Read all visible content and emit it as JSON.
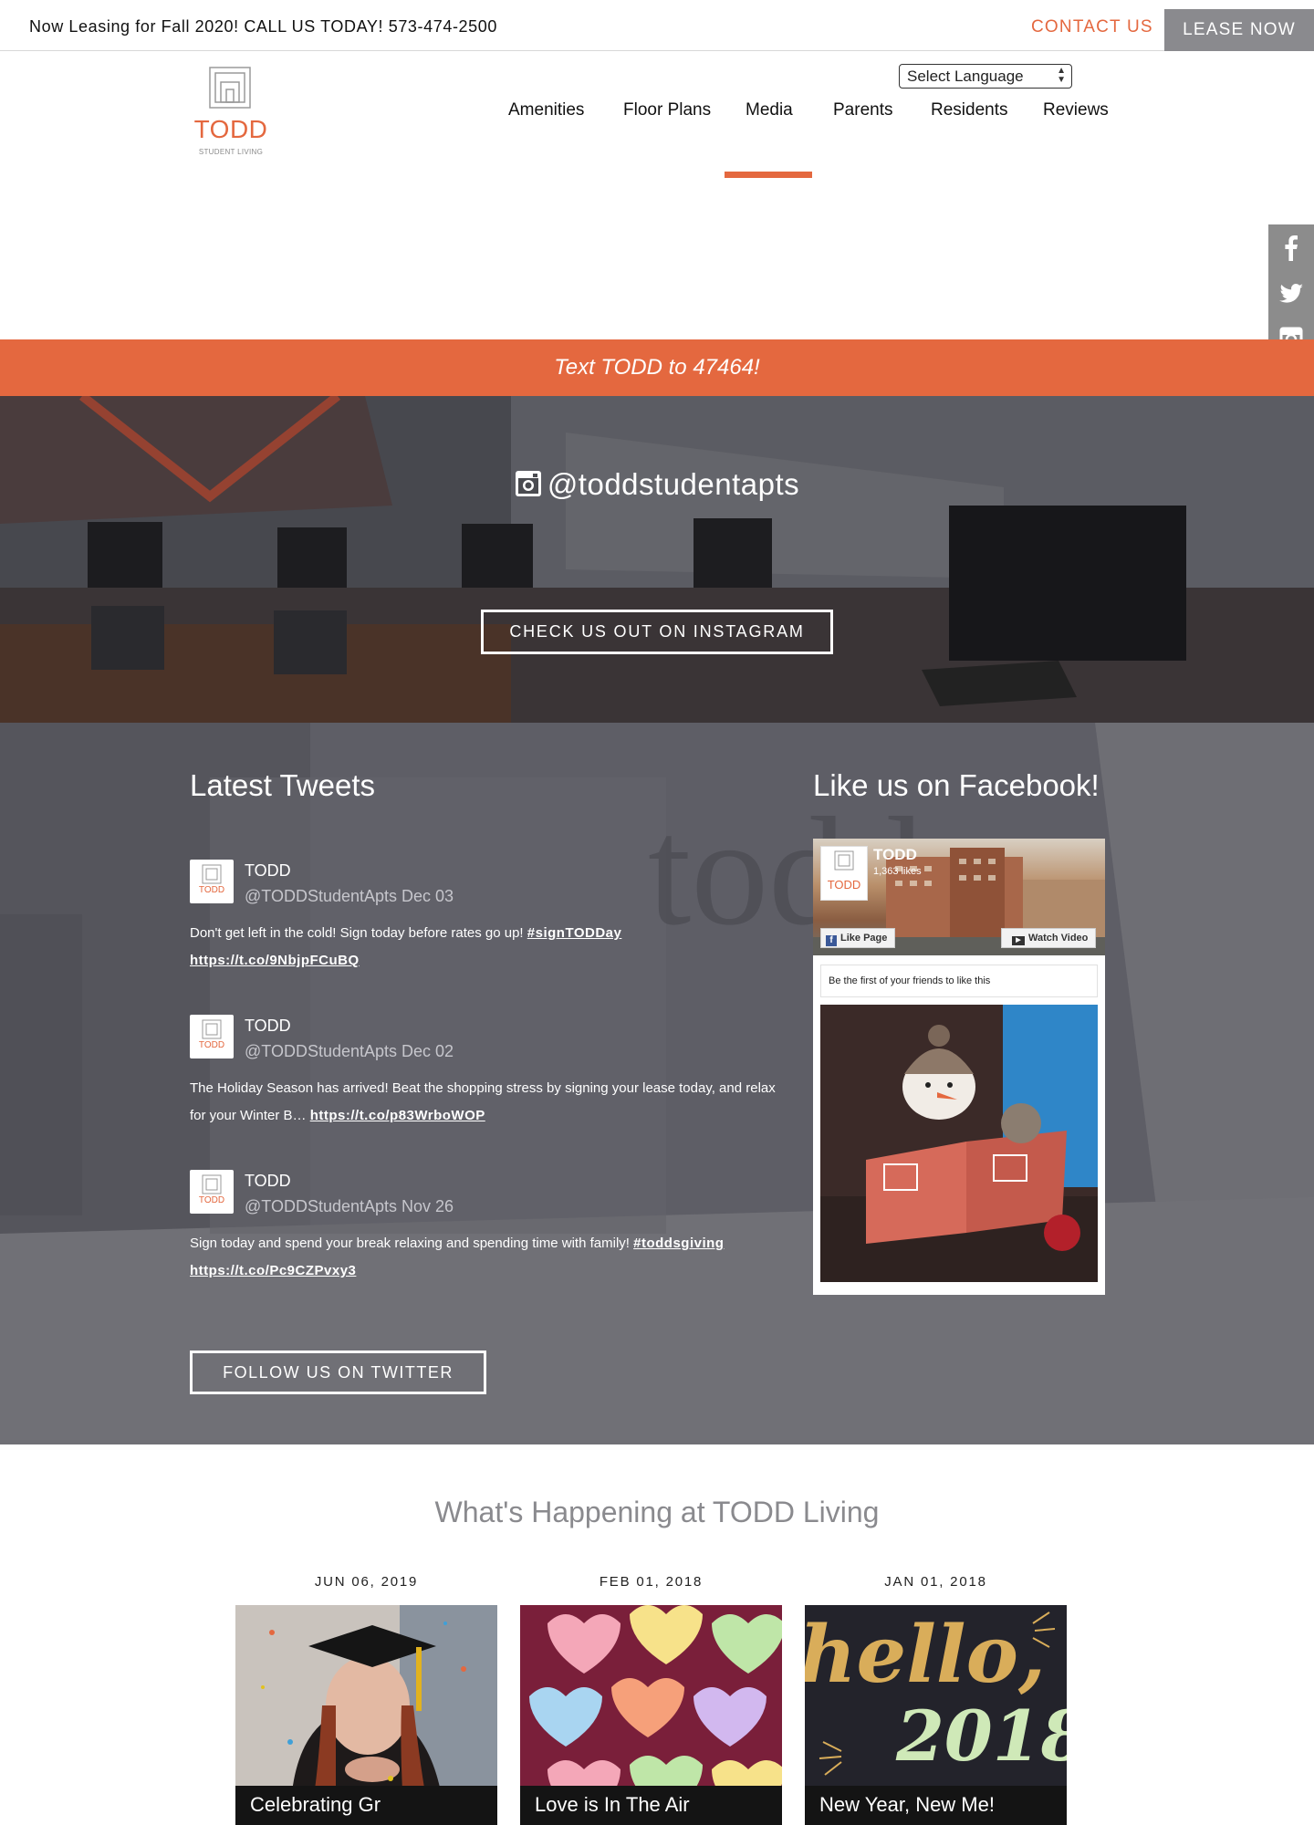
{
  "topbar": {
    "promo": "Now Leasing for Fall 2020! CALL US TODAY! 573-474-2500",
    "contact": "CONTACT US",
    "lease": "LEASE NOW"
  },
  "brand": {
    "name": "TODD",
    "tagline": "STUDENT LIVING"
  },
  "language": {
    "selected": "Select Language"
  },
  "nav": {
    "items": [
      "Amenities",
      "Floor Plans",
      "Media",
      "Parents",
      "Residents",
      "Reviews"
    ],
    "active": "Media"
  },
  "social": [
    "facebook-icon",
    "twitter-icon",
    "instagram-icon"
  ],
  "textbar": "Text TODD to 47464!",
  "instagram": {
    "handle": "@toddstudentapts",
    "button": "CHECK US OUT ON INSTAGRAM"
  },
  "tweets": {
    "title": "Latest Tweets",
    "items": [
      {
        "name": "TODD",
        "handle": "@TODDStudentApts",
        "date": "Dec 03",
        "text": "Don't get left in the cold! Sign today before rates go up! ",
        "tag": "#signTODDay",
        "link": "https://t.co/9NbjpFCuBQ"
      },
      {
        "name": "TODD",
        "handle": "@TODDStudentApts",
        "date": "Dec 02",
        "text": "The Holiday Season has arrived! Beat the shopping stress by signing your lease today, and relax for your Winter B… ",
        "tag": "",
        "link": "https://t.co/p83WrboWOP"
      },
      {
        "name": "TODD",
        "handle": "@TODDStudentApts",
        "date": "Nov 26",
        "text": "Sign today and spend your break relaxing and spending time with family! ",
        "tag": "#toddsgiving",
        "link": "https://t.co/Pc9CZPvxy3"
      }
    ],
    "follow": "FOLLOW US ON TWITTER"
  },
  "facebook": {
    "title": "Like us on Facebook!",
    "page_name": "TODD",
    "likes": "1,363 likes",
    "like_button": "Like Page",
    "watch_button": "Watch Video",
    "friends_text": "Be the first of your friends to like this"
  },
  "happening": {
    "title": "What's Happening at TODD Living",
    "events": [
      {
        "date": "JUN 06, 2019",
        "caption": "Celebrating Gr"
      },
      {
        "date": "FEB 01, 2018",
        "caption": "Love is In The Air"
      },
      {
        "date": "JAN 01, 2018",
        "caption": "New Year, New Me!"
      }
    ],
    "image_text": {
      "hello": "hello,",
      "year": "2018"
    }
  },
  "colors": {
    "accent": "#e4683f",
    "lease_bg": "#8a8a8e",
    "social_bg": "#8c8c8c",
    "section_title": "#8a8a8e"
  }
}
